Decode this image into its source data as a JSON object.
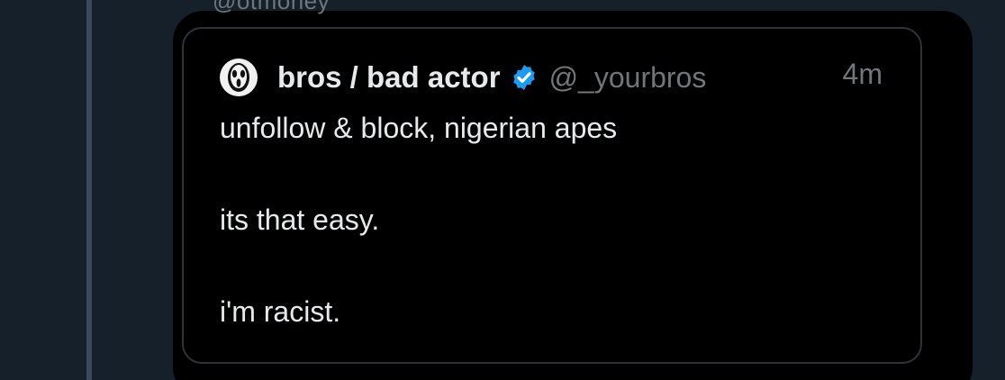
{
  "above_text": "@otmoney",
  "quote": {
    "display_name": "bros / bad actor",
    "handle": "@_yourbros",
    "time": "4m",
    "avatar_icon": "ghostface-mask-icon",
    "verified_icon": "verified-badge-icon",
    "verified_color": "#1d9bf0",
    "lines": [
      "unfollow & block, nigerian apes",
      "its that easy.",
      "i'm racist."
    ]
  }
}
